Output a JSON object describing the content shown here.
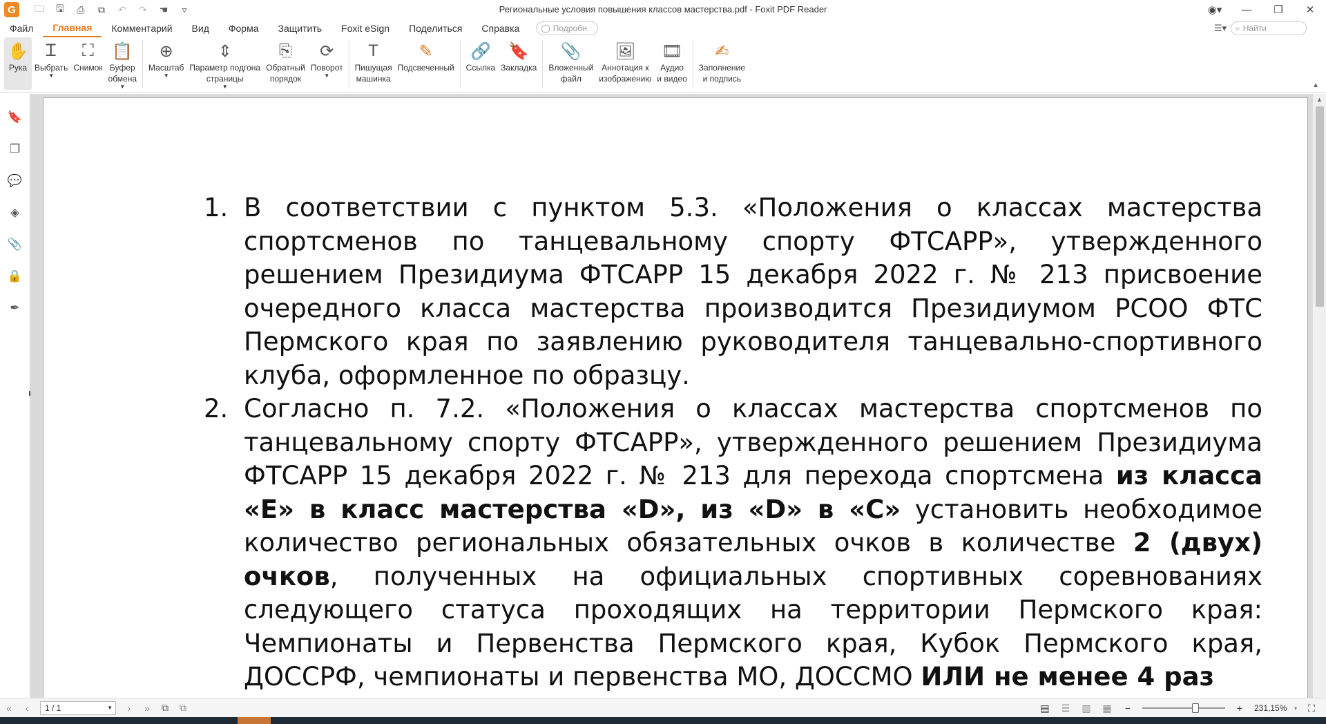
{
  "window": {
    "title": "Региональные условия повышения классов мастерства.pdf - Foxit PDF Reader",
    "logo": "G"
  },
  "quick_access": [
    {
      "name": "open-icon",
      "glyph": "🗀"
    },
    {
      "name": "save-icon",
      "glyph": "🖫"
    },
    {
      "name": "print-icon",
      "glyph": "⎙"
    },
    {
      "name": "save-as-icon",
      "glyph": "⧉"
    },
    {
      "name": "undo-icon",
      "glyph": "↶"
    },
    {
      "name": "redo-icon",
      "glyph": "↷"
    },
    {
      "name": "hand-tool-icon",
      "glyph": "☚"
    },
    {
      "name": "customize-icon",
      "glyph": "▿"
    }
  ],
  "menu": {
    "items": [
      "Файл",
      "Главная",
      "Комментарий",
      "Вид",
      "Форма",
      "Защитить",
      "Foxit eSign",
      "Поделиться",
      "Справка"
    ],
    "active_index": 1,
    "tellme_placeholder": "Подробн",
    "search_placeholder": "Найти"
  },
  "ribbon": {
    "groups": [
      [
        {
          "name": "hand-button",
          "icon": "hand-icon",
          "glyph": "✋",
          "label": "Рука",
          "active": true
        },
        {
          "name": "select-button",
          "icon": "select-text-icon",
          "glyph": "Ꮖ",
          "label": "Выбрать",
          "caret": true
        },
        {
          "name": "snapshot-button",
          "icon": "snapshot-icon",
          "glyph": "⛶",
          "label": "Снимок"
        },
        {
          "name": "clipboard-button",
          "icon": "clipboard-icon",
          "glyph": "📋",
          "label": "Буфер\nобмена",
          "caret": true
        }
      ],
      [
        {
          "name": "zoom-button",
          "icon": "zoom-icon",
          "glyph": "⊕",
          "label": "Масштаб",
          "caret": true
        },
        {
          "name": "page-fit-button",
          "icon": "page-fit-icon",
          "glyph": "⇕",
          "label": "Параметр подгона\nстраницы",
          "caret": true
        },
        {
          "name": "reverse-order-button",
          "icon": "reverse-order-icon",
          "glyph": "⎘",
          "label": "Обратный\nпорядок"
        },
        {
          "name": "rotate-button",
          "icon": "rotate-icon",
          "glyph": "⟳",
          "label": "Поворот",
          "caret": true
        }
      ],
      [
        {
          "name": "typewriter-button",
          "icon": "typewriter-icon",
          "glyph": "T",
          "label": "Пишущая\nмашинка"
        },
        {
          "name": "highlight-button",
          "icon": "highlight-icon",
          "glyph": "✎",
          "label": "Подсвеченный"
        }
      ],
      [
        {
          "name": "link-button",
          "icon": "link-icon",
          "glyph": "🔗",
          "label": "Ссылка"
        },
        {
          "name": "bookmark-button",
          "icon": "bookmark-icon",
          "glyph": "🔖",
          "label": "Закладка"
        }
      ],
      [
        {
          "name": "attached-file-button",
          "icon": "attached-file-icon",
          "glyph": "📎",
          "label": "Вложенный\nфайл"
        },
        {
          "name": "image-annotation-button",
          "icon": "image-annotation-icon",
          "glyph": "🖼",
          "label": "Аннотация к\nизображению"
        },
        {
          "name": "audio-video-button",
          "icon": "audio-video-icon",
          "glyph": "🎞",
          "label": "Аудио\nи видео"
        }
      ],
      [
        {
          "name": "fill-sign-button",
          "icon": "fill-sign-icon",
          "glyph": "✍",
          "label": "Заполнение\nи подпись"
        }
      ]
    ]
  },
  "left_nav": [
    {
      "name": "bookmarks-panel-icon",
      "glyph": "🔖"
    },
    {
      "name": "pages-panel-icon",
      "glyph": "❐"
    },
    {
      "name": "comments-panel-icon",
      "glyph": "💬"
    },
    {
      "name": "layers-panel-icon",
      "glyph": "◈"
    },
    {
      "name": "attachments-panel-icon",
      "glyph": "📎"
    },
    {
      "name": "security-panel-icon",
      "glyph": "🔒"
    },
    {
      "name": "signature-panel-icon",
      "glyph": "✒"
    }
  ],
  "document": {
    "item1": {
      "num": "1.",
      "text": "В соответствии с пунктом 5.3. «Положения о классах мастерства спортсменов по танцевальному спорту ФТСАРР», утвержденного решением Президиума ФТСАРР 15 декабря 2022 г. № 213 присвоение очередного класса мастерства производится Президиумом РСОО ФТС Пермского края по заявлению руководителя танцевально-спортивного клуба, оформленное по образцу."
    },
    "item2": {
      "num": "2.",
      "t1": "Согласно п. 7.2. «Положения о классах мастерства спортсменов по танцевальному спорту ФТСАРР», утвержденного решением Президиума ФТСАРР 15 декабря 2022 г. № 213 для перехода спортсмена ",
      "b1": "из класса «Е» в класс мастерства «D», из «D» в «С»",
      "t2": " установить необходимое количество региональных обязательных очков в количестве ",
      "b2": "2 (двух) очков",
      "t3": ", полученных на официальных спортивных соревнованиях следующего статуса проходящих на территории Пермского края: Чемпионаты и Первенства Пермского края, Кубок Пермского края, ДОССРФ, чемпионаты и первенства МО, ДОССМО ",
      "b3": "ИЛИ не менее 4 раз"
    }
  },
  "status": {
    "page_indicator": "1 / 1",
    "zoom": "231,15%"
  }
}
